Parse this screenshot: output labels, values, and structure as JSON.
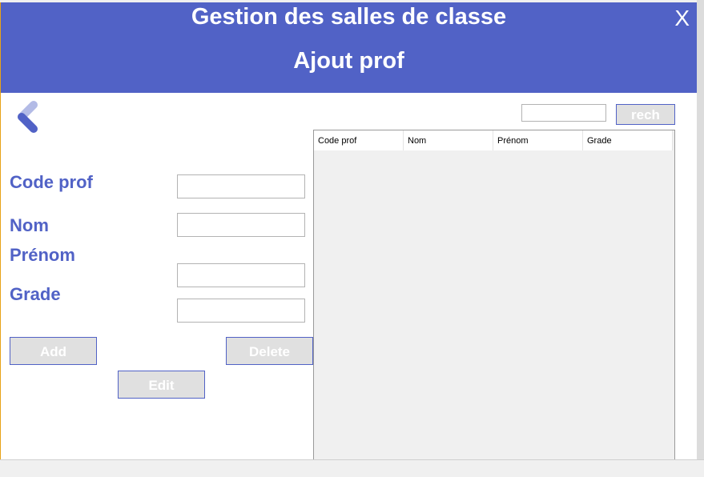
{
  "header": {
    "title": "Gestion des salles de classe",
    "subtitle": "Ajout prof",
    "close_label": "X"
  },
  "search": {
    "value": "",
    "button_label": "rech"
  },
  "form": {
    "fields": [
      {
        "label": "Code prof",
        "value": ""
      },
      {
        "label": "Nom",
        "value": ""
      },
      {
        "label": "Prénom",
        "value": ""
      },
      {
        "label": "Grade",
        "value": ""
      }
    ],
    "add_label": "Add",
    "delete_label": "Delete",
    "edit_label": "Edit"
  },
  "table": {
    "columns": [
      "Code prof",
      "Nom",
      "Prénom",
      "Grade"
    ],
    "rows": []
  },
  "colors": {
    "accent": "#5162c6",
    "back_icon_light": "#b3bbe6",
    "button_bg": "#e0e0e0"
  },
  "icons": {
    "back": "chevron-left-icon"
  }
}
